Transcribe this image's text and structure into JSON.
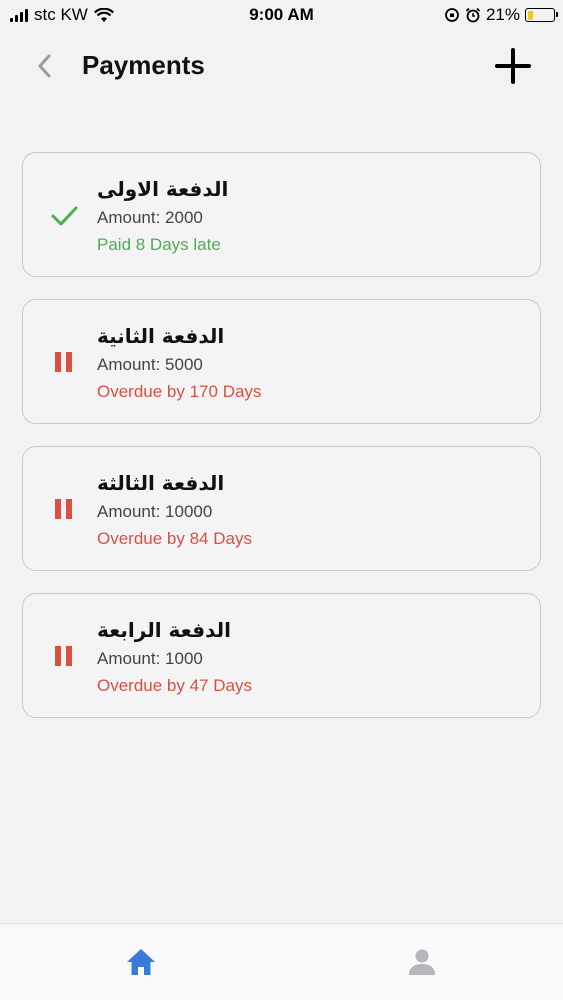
{
  "status_bar": {
    "carrier": "stc KW",
    "time": "9:00 AM",
    "battery": "21%",
    "battery_level": 0.21
  },
  "header": {
    "title": "Payments",
    "back_icon": "chevron-left-icon",
    "add_icon": "plus-icon"
  },
  "colors": {
    "paid": "#4cae4c",
    "overdue": "#d9503f",
    "tab_active": "#3a7ad8",
    "tab_inactive": "#b5b5ba"
  },
  "payments": [
    {
      "name": "الدفعة الاولى",
      "amount": "Amount: 2000",
      "status": "Paid 8 Days late",
      "state": "paid",
      "icon": "check-icon"
    },
    {
      "name": "الدفعة الثانية",
      "amount": "Amount: 5000",
      "status": "Overdue by 170 Days",
      "state": "overdue",
      "icon": "pause-icon"
    },
    {
      "name": "الدفعة الثالثة",
      "amount": "Amount: 10000",
      "status": "Overdue by 84 Days",
      "state": "overdue",
      "icon": "pause-icon"
    },
    {
      "name": "الدفعة الرابعة",
      "amount": "Amount: 1000",
      "status": "Overdue by 47 Days",
      "state": "overdue",
      "icon": "pause-icon"
    }
  ],
  "tabs": [
    {
      "name": "home",
      "icon": "home-icon",
      "active": true
    },
    {
      "name": "profile",
      "icon": "person-icon",
      "active": false
    }
  ]
}
